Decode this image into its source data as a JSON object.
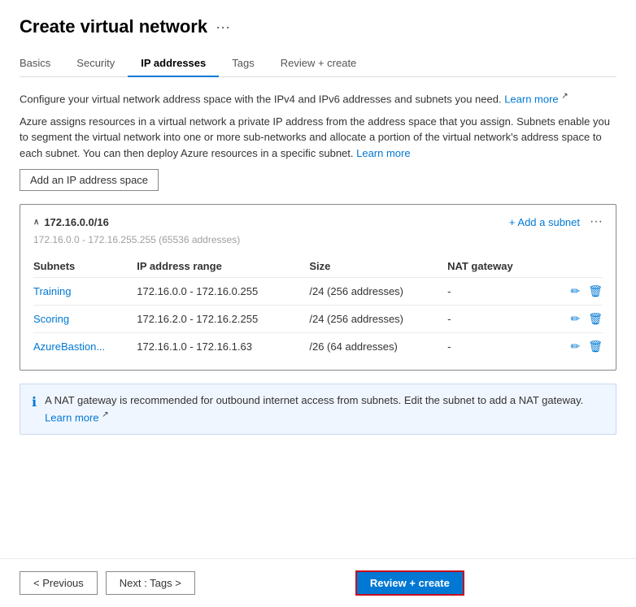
{
  "page": {
    "title": "Create virtual network",
    "more_icon": "···"
  },
  "tabs": [
    {
      "id": "basics",
      "label": "Basics",
      "active": false
    },
    {
      "id": "security",
      "label": "Security",
      "active": false
    },
    {
      "id": "ip-addresses",
      "label": "IP addresses",
      "active": true
    },
    {
      "id": "tags",
      "label": "Tags",
      "active": false
    },
    {
      "id": "review-create",
      "label": "Review + create",
      "active": false
    }
  ],
  "description": {
    "line1_prefix": "Configure your virtual network address space with the IPv4 and IPv6 addresses and subnets you need. ",
    "line1_link": "Learn more",
    "line2": "Azure assigns resources in a virtual network a private IP address from the address space that you assign. Subnets enable you to segment the virtual network into one or more sub-networks and allocate a portion of the virtual network's address space to each subnet. You can then deploy Azure resources in a specific subnet. ",
    "line2_link": "Learn more"
  },
  "add_ip_button": "Add an IP address space",
  "address_space": {
    "cidr": "172.16.0.0/16",
    "range_label": "172.16.0.0 - 172.16.255.255 (65536 addresses)",
    "add_subnet_label": "+ Add a subnet",
    "more_icon": "···",
    "columns": [
      {
        "id": "subnets",
        "label": "Subnets"
      },
      {
        "id": "ip-range",
        "label": "IP address range"
      },
      {
        "id": "size",
        "label": "Size"
      },
      {
        "id": "nat-gateway",
        "label": "NAT gateway"
      }
    ],
    "rows": [
      {
        "name": "Training",
        "ip_range": "172.16.0.0 - 172.16.0.255",
        "size": "/24 (256 addresses)",
        "nat_gateway": "-"
      },
      {
        "name": "Scoring",
        "ip_range": "172.16.2.0 - 172.16.2.255",
        "size": "/24 (256 addresses)",
        "nat_gateway": "-"
      },
      {
        "name": "AzureBastion...",
        "ip_range": "172.16.1.0 - 172.16.1.63",
        "size": "/26 (64 addresses)",
        "nat_gateway": "-"
      }
    ]
  },
  "info_banner": {
    "text": "A NAT gateway is recommended for outbound internet access from subnets. Edit the subnet to add a NAT gateway. ",
    "link": "Learn more"
  },
  "footer": {
    "previous_label": "< Previous",
    "next_label": "Next : Tags >",
    "review_create_label": "Review + create"
  }
}
